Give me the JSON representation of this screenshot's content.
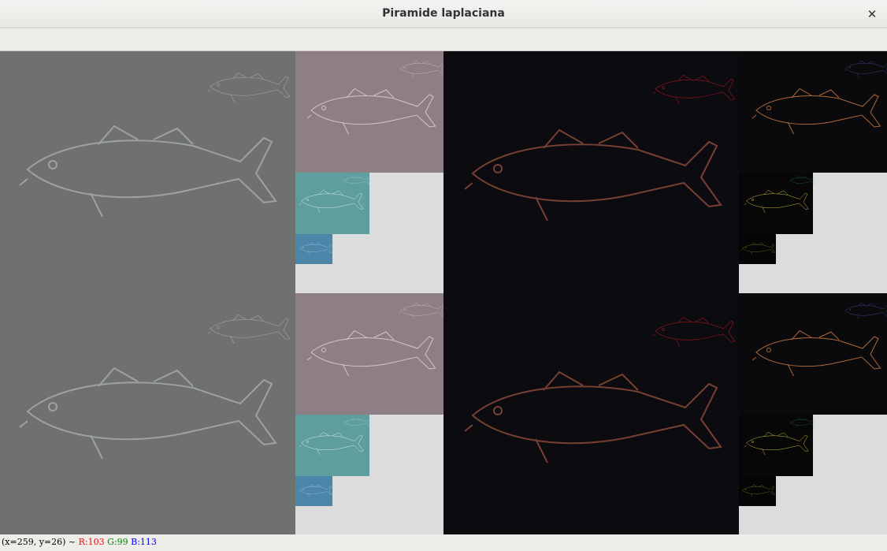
{
  "window": {
    "title": "Piramide laplaciana",
    "close_glyph": "✕"
  },
  "icons": {
    "close": "close-icon"
  },
  "colors": {
    "level0_gray": "#6f7171",
    "level1_mauve": "#8e7e85",
    "level2_teal": "#5f9e9e",
    "level3_blue": "#4b86a9",
    "dark_panel": "#0b0b10",
    "empty_area": "#dcdcdc",
    "status_red": "#ff0000",
    "status_green": "#008800",
    "status_blue": "#0000ff"
  },
  "status": {
    "coords": "(x=259, y=26) ~",
    "r": "R:103",
    "g": "G:99",
    "b": "B:113"
  }
}
